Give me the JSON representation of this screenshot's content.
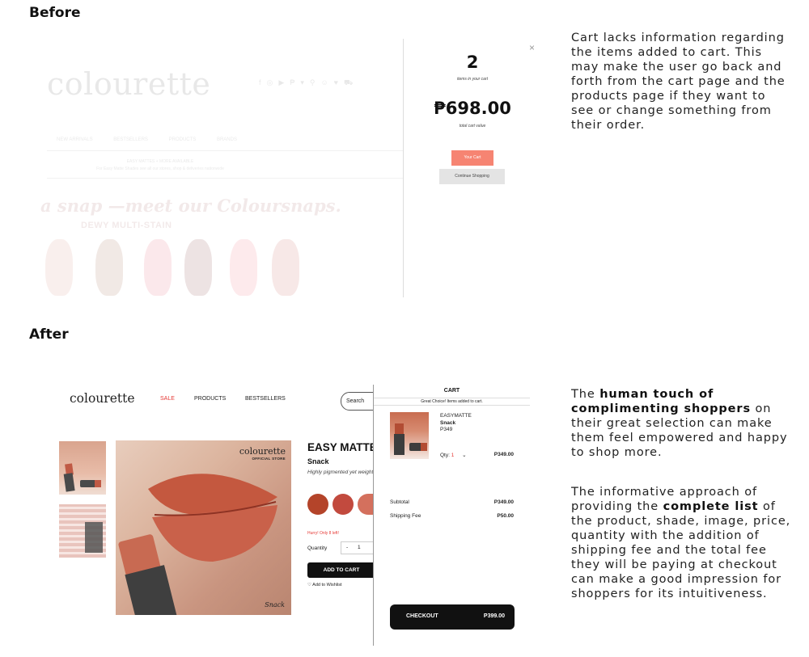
{
  "before": {
    "heading": "Before",
    "site": {
      "logo": "colourette",
      "nav": [
        "NEW ARRIVALS",
        "BESTSELLERS",
        "PRODUCTS",
        "BRANDS"
      ],
      "promo_line1": "EASY MATTES + MORE AVAILABLE",
      "promo_line2": "For Easy Matte Shades see all our stores, shop & deliveries nationwide",
      "tagline": "a snap —meet our Coloursnaps.",
      "subheading": "DEWY MULTI-STAIN"
    },
    "cart_popup": {
      "close": "×",
      "count": "2",
      "count_label": "items in your cart",
      "total": "₱698.00",
      "total_label": "total cart value",
      "your_cart_button": "Your Cart",
      "continue_button": "Continue Shopping"
    },
    "note": "Cart lacks information regarding the items added to cart. This may make the user go back and forth from the cart page and the products page if they want to see or change something from their order."
  },
  "after": {
    "heading": "After",
    "header": {
      "logo": "colourette",
      "nav_sale": "SALE",
      "nav_products": "PRODUCTS",
      "nav_bestsellers": "BESTSELLERS",
      "search_placeholder": "Search"
    },
    "hero": {
      "brand": "colourette",
      "brand_sub": "OFFICIAL STORE",
      "caption": "Snack"
    },
    "product": {
      "title": "EASY MATTE",
      "shade": "Snack",
      "description": "Highly pigmented yet weightless",
      "shade_colors": [
        "#b4442a",
        "#c24a3e",
        "#d4705d"
      ],
      "stock_note": "Hurry! Only 8 left!",
      "quantity_label": "Quantity",
      "qty_minus": "-",
      "qty_value": "1",
      "add_to_cart": "ADD TO CART",
      "wishlist": "Add to Wishlist"
    },
    "cart": {
      "title": "CART",
      "banner": "Great Choice! Items added to cart.",
      "item_line1": "EASYMATTE",
      "item_line2": "Snack",
      "item_line3": "P349",
      "qty_label": "Qty:",
      "qty_value": "1",
      "item_price": "P349.00",
      "subtotal_label": "Subtotal",
      "subtotal_value": "P349.00",
      "shipping_label": "Shipping Fee",
      "shipping_value": "P50.00",
      "checkout_label": "CHECKOUT",
      "checkout_total": "P399.00"
    },
    "note1_pre": "The ",
    "note1_bold": "human touch of complimenting shoppers",
    "note1_post": " on their great selection can make them feel empowered and happy to shop more.",
    "note2_pre": "The informative approach of providing the ",
    "note2_bold": "complete list",
    "note2_post": " of the product, shade, image, price, quantity with the addition of shipping fee and the total fee they will be paying at checkout can make a good impression for shoppers for its intuitiveness."
  }
}
